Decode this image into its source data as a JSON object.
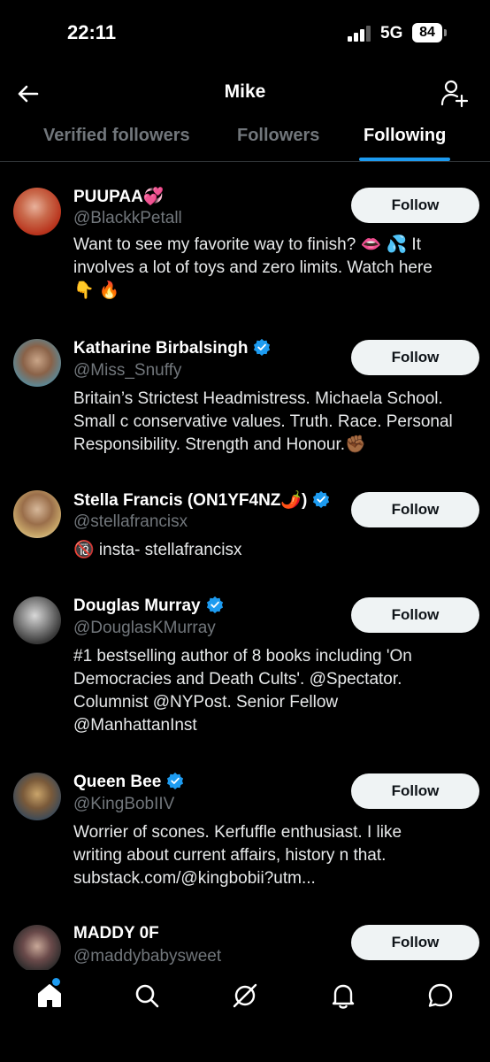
{
  "status_bar": {
    "time": "22:11",
    "network": "5G",
    "battery": "84"
  },
  "header": {
    "title": "Mike",
    "back_icon": "back-arrow-icon",
    "add_icon": "add-user-icon"
  },
  "tabs": [
    {
      "label": "Verified followers",
      "active": false
    },
    {
      "label": "Followers",
      "active": false
    },
    {
      "label": "Following",
      "active": true
    }
  ],
  "colors": {
    "accent": "#1d9bf0",
    "background": "#000000",
    "secondary_text": "#71767b",
    "button_bg": "#eff3f4"
  },
  "users": [
    {
      "name": "PUUPAA💞",
      "handle": "@BlackkPetall",
      "verified": false,
      "bio_lines": [
        "Want to see my favorite way to finish? 👄 💦 It",
        "involves a lot of toys and zero limits. Watch here",
        "👇 🔥"
      ],
      "button": "Follow"
    },
    {
      "name": "Katharine Birbalsingh",
      "handle": "@Miss_Snuffy",
      "verified": true,
      "bio_lines": [
        "Britain’s Strictest Headmistress. Michaela School.",
        "Small c conservative values. Truth. Race. Personal",
        "Responsibility. Strength and Honour.✊🏾"
      ],
      "button": "Follow"
    },
    {
      "name": "Stella Francis (ON1YF4NZ🌶️)",
      "handle": "@stellafrancisx",
      "verified": true,
      "bio_lines": [
        "🔞 insta- stellafrancisx"
      ],
      "button": "Follow"
    },
    {
      "name": "Douglas Murray",
      "handle": "@DouglasKMurray",
      "verified": true,
      "bio_lines": [
        "#1 bestselling author of 8 books including 'On",
        "Democracies and Death Cults'. @Spectator.",
        "Columnist @NYPost. Senior Fellow",
        "@ManhattanInst"
      ],
      "button": "Follow"
    },
    {
      "name": "Queen Bee",
      "handle": "@KingBobIIV",
      "verified": true,
      "bio_lines": [
        "Worrier of scones. Kerfuffle enthusiast. I like",
        "writing about current affairs, history n that.",
        "substack.com/@kingbobii?utm..."
      ],
      "button": "Follow"
    },
    {
      "name": "MADDY 0F",
      "handle": "@maddybabysweet",
      "verified": false,
      "bio_lines": [],
      "button": "Follow"
    }
  ],
  "bottom_nav": [
    {
      "icon": "home-icon"
    },
    {
      "icon": "search-icon"
    },
    {
      "icon": "grok-icon"
    },
    {
      "icon": "bell-icon"
    },
    {
      "icon": "messages-icon"
    }
  ]
}
